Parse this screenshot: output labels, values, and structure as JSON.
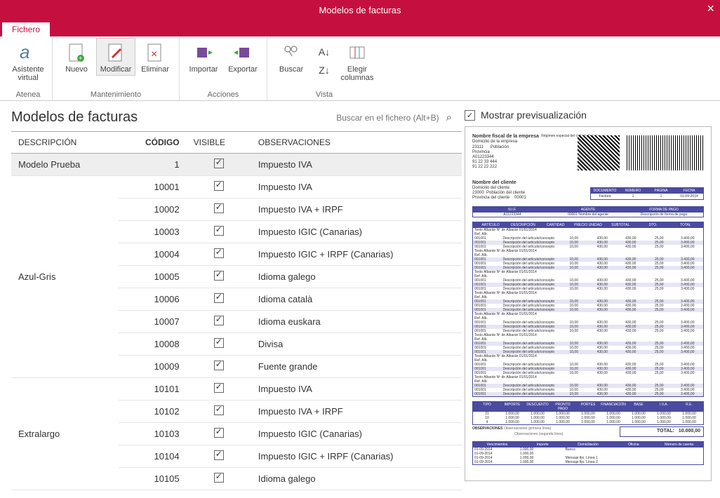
{
  "window": {
    "title": "Modelos de facturas"
  },
  "tabs": {
    "file": "Fichero"
  },
  "ribbon": {
    "assistant": {
      "label": "Asistente\nvirtual",
      "group": "Atenea"
    },
    "new": "Nuevo",
    "modify": "Modificar",
    "delete": "Eliminar",
    "maint_group": "Mantenimiento",
    "import": "Importar",
    "export": "Exportar",
    "actions_group": "Acciones",
    "search": "Buscar",
    "columns": "Elegir\ncolumnas",
    "view_group": "Vista"
  },
  "page": {
    "title": "Modelos de facturas",
    "search_placeholder": "Buscar en el fichero (Alt+B)"
  },
  "grid": {
    "cols": {
      "desc": "DESCRIPCIÓN",
      "code": "CÓDIGO",
      "visible": "VISIBLE",
      "obs": "OBSERVACIONES"
    },
    "rows": [
      {
        "group": "Modelo Prueba",
        "code": "1",
        "vis": true,
        "obs": "Impuesto IVA",
        "sel": true
      },
      {
        "group": "Azul-Gris",
        "code": "10001",
        "vis": true,
        "obs": "Impuesto IVA"
      },
      {
        "group": "",
        "code": "10002",
        "vis": true,
        "obs": "Impuesto IVA + IRPF"
      },
      {
        "group": "",
        "code": "10003",
        "vis": true,
        "obs": "Impuesto IGIC (Canarias)"
      },
      {
        "group": "",
        "code": "10004",
        "vis": true,
        "obs": "Impuesto IGIC + IRPF (Canarias)"
      },
      {
        "group": "",
        "code": "10005",
        "vis": true,
        "obs": "Idioma galego"
      },
      {
        "group": "",
        "code": "10006",
        "vis": true,
        "obs": "Idioma català"
      },
      {
        "group": "",
        "code": "10007",
        "vis": true,
        "obs": "Idioma euskara"
      },
      {
        "group": "",
        "code": "10008",
        "vis": true,
        "obs": "Divisa"
      },
      {
        "group": "",
        "code": "10009",
        "vis": true,
        "obs": "Fuente grande"
      },
      {
        "group": "Extralargo",
        "code": "10101",
        "vis": true,
        "obs": "Impuesto IVA"
      },
      {
        "group": "",
        "code": "10102",
        "vis": true,
        "obs": "Impuesto IVA + IRPF"
      },
      {
        "group": "",
        "code": "10103",
        "vis": true,
        "obs": "Impuesto IGIC (Canarias)"
      },
      {
        "group": "",
        "code": "10104",
        "vis": true,
        "obs": "Impuesto IGIC + IRPF (Canarias)"
      },
      {
        "group": "",
        "code": "10105",
        "vis": true,
        "obs": "Idioma galego"
      }
    ],
    "groups": [
      {
        "label": "Modelo Prueba",
        "start": 0,
        "span": 1
      },
      {
        "label": "Azul-Gris",
        "start": 1,
        "span": 9
      },
      {
        "label": "Extralargo",
        "start": 10,
        "span": 5
      }
    ]
  },
  "preview": {
    "checkbox_label": "Mostrar previsualización",
    "company": "Nombre fiscal de la empresa",
    "company_addr": "Domicilio de la empresa",
    "company_cp": "23111",
    "company_pob": "Población",
    "company_prov": "Provincia",
    "company_nif": "A01223344",
    "company_tel": "91 22 33 444",
    "company_mov": "91 22 22 222",
    "special": "Régimen especial del criterio de caja",
    "client": "Nombre del cliente",
    "client_addr": "Domicilio del cliente",
    "client_cp": "23000",
    "client_pob": "Población del cliente",
    "client_prov": "Provincia del cliente",
    "client_code": "00001",
    "doc_headers": [
      "DOCUMENTO",
      "NÚMERO",
      "PÁGINA",
      "FECHA"
    ],
    "doc_values": [
      "Factura",
      "1",
      "1",
      "01-09-2014"
    ],
    "nif_headers": [
      "N.I.F.",
      "AGENTE",
      "FORMA DE PAGO"
    ],
    "nif_values": [
      "A11223344",
      "00001  Nombre del agente",
      "Descripción de forma de pago"
    ],
    "item_headers": [
      "ARTÍCULO",
      "DESCRIPCIÓN",
      "CANTIDAD",
      "PRECIO UNIDAD",
      "SUBTOTAL",
      "DTO.",
      "TOTAL"
    ],
    "item_sample": {
      "art": "001001",
      "desc": "Descripción del artículo/concepto",
      "cant": "10,00",
      "pu": "430,00",
      "sub": "430,00",
      "dto": "25,00",
      "tot": "3.400,00"
    },
    "item_sublabel": "Texto Albarán    Nº de Albarán    01/01/2014    Ref. Alb.",
    "totals_headers": [
      "TIPO",
      "IMPORTE",
      "DESCUENTO",
      "PRONTO PAGO",
      "PORTES",
      "FINANCIACIÓN",
      "BASE",
      "I.V.A.",
      "R.E."
    ],
    "totals_rows": [
      [
        "21",
        "1.000,00",
        "1.000,00",
        "1.000,00",
        "1.000,00",
        "1.000,00",
        "1.000,00",
        "1.000,00",
        "1.000,00"
      ],
      [
        "10",
        "1.000,00",
        "1.000,00",
        "1.000,00",
        "1.000,00",
        "1.000,00",
        "1.000,00",
        "1.000,00",
        "1.000,00"
      ],
      [
        "4",
        "1.000,00",
        "1.000,00",
        "1.000,00",
        "1.000,00",
        "1.000,00",
        "1.000,00",
        "1.000,00",
        "1.000,00"
      ]
    ],
    "obs_label": "OBSERVACIONES",
    "obs1": "Observaciones (primera línea)",
    "obs2": "Observaciones (segunda línea)",
    "total_label": "TOTAL:",
    "total_value": "10.000,00",
    "venc_headers": [
      "Vencimientos",
      "Importe",
      "Domiciliación",
      "Oficina",
      "Número de cuenta"
    ],
    "venc_rows": [
      [
        "01-09-2014",
        "1.000,00",
        "Banco",
        "",
        ""
      ],
      [
        "01-09-2014",
        "1.000,00",
        "",
        "",
        ""
      ],
      [
        "01-09-2014",
        "1.000,00",
        "Mensaje fijo. Línea 1",
        "",
        ""
      ],
      [
        "01-09-2014",
        "1.000,00",
        "Mensaje fijo. Línea 2",
        "",
        ""
      ]
    ]
  }
}
